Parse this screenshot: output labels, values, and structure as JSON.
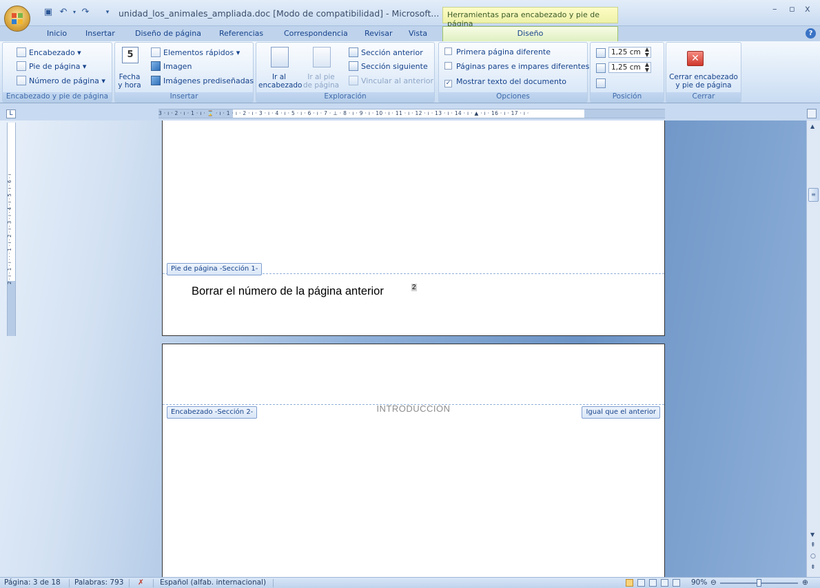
{
  "window": {
    "title": "unidad_los_animales_ampliada.doc [Modo de compatibilidad] - Microsoft...",
    "context_tab_title": "Herramientas para encabezado y pie de página",
    "controls": {
      "minimize": "–",
      "restore": "▫",
      "close": "x"
    }
  },
  "tabs": [
    {
      "label": "Inicio"
    },
    {
      "label": "Insertar"
    },
    {
      "label": "Diseño de página"
    },
    {
      "label": "Referencias"
    },
    {
      "label": "Correspondencia"
    },
    {
      "label": "Revisar"
    },
    {
      "label": "Vista"
    }
  ],
  "active_tab": {
    "label": "Diseño"
  },
  "ribbon": {
    "group1": {
      "label": "Encabezado y pie de página",
      "items": [
        "Encabezado ▾",
        "Pie de página ▾",
        "Número de página ▾"
      ]
    },
    "group2": {
      "label": "Insertar",
      "fecha_l1": "Fecha",
      "fecha_l2": "y hora",
      "fecha_icon_text": "5",
      "items": [
        "Elementos rápidos ▾",
        "Imagen",
        "Imágenes prediseñadas"
      ]
    },
    "group3": {
      "label": "Exploración",
      "ir_encab_l1": "Ir al",
      "ir_encab_l2": "encabezado",
      "ir_pie_l1": "Ir al pie",
      "ir_pie_l2": "de página",
      "items": [
        "Sección anterior",
        "Sección siguiente",
        "Vincular al anterior"
      ]
    },
    "group4": {
      "label": "Opciones",
      "options": [
        {
          "label": "Primera página diferente",
          "checked": false
        },
        {
          "label": "Páginas pares e impares diferentes",
          "checked": false
        },
        {
          "label": "Mostrar texto del documento",
          "checked": true
        }
      ]
    },
    "group5": {
      "label": "Posición",
      "header_pos": "1,25 cm",
      "footer_pos": "1,25 cm"
    },
    "group6": {
      "label": "Cerrar",
      "close_l1": "Cerrar encabezado",
      "close_l2": "y pie de página"
    }
  },
  "ruler": {
    "corner": "L",
    "text": "3 · ı · 2 · ı · 1 · ı · ⌛ · ı · 1 · ı · 2 · ı · 3 · ı · 4 · ı · 5 · ı · 6 · ı · 7 · ⊥ · 8 · ı · 9 · ı · 10 · ı · 11 · ı · 12 · ı · 13 · ı · 14 · ı · ▲ · ı · 16 · ı · 17 · ı ·",
    "vertical_text": "2 · ı · 1 · ı · · · 1 · ı · 2 · ı · 3 · ı · 4 · ı · 5 · ı · 6 · ı"
  },
  "page1": {
    "footer_tag": "Pie de página -Sección 1-",
    "footer_text": "Borrar el número de la página anterior",
    "page_number": "2"
  },
  "page2": {
    "header_tag": "Encabezado -Sección 2-",
    "header_text": "INTRODUCCION",
    "same_as_previous": "Igual que el anterior"
  },
  "statusbar": {
    "page": "Página: 3 de 18",
    "words": "Palabras: 793",
    "language": "Español (alfab. internacional)",
    "zoom": "90%"
  },
  "colors": {
    "ribbon_text": "#15428b",
    "workspace_blue": "#6b93c5",
    "context_tab": "#eef2a8"
  }
}
